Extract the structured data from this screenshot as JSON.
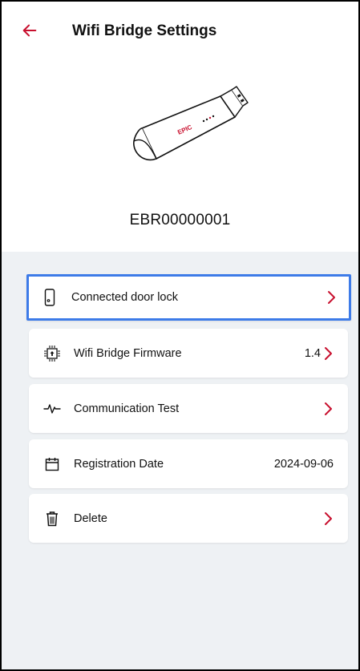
{
  "header": {
    "back_icon": "arrow-left-icon",
    "title": "Wifi Bridge Settings"
  },
  "device": {
    "brand": "EPIC",
    "serial": "EBR00000001"
  },
  "menu": [
    {
      "label": "Connected door lock",
      "value": "",
      "icon": "door-lock-icon",
      "chevron": true,
      "selected": true
    },
    {
      "label": "Wifi Bridge Firmware",
      "value": "1.4",
      "icon": "chip-icon",
      "chevron": true,
      "selected": false
    },
    {
      "label": "Communication Test",
      "value": "",
      "icon": "pulse-icon",
      "chevron": true,
      "selected": false
    },
    {
      "label": "Registration Date",
      "value": "2024-09-06",
      "icon": "calendar-icon",
      "chevron": false,
      "selected": false
    },
    {
      "label": "Delete",
      "value": "",
      "icon": "trash-icon",
      "chevron": true,
      "selected": false
    }
  ],
  "colors": {
    "accent_red": "#c8102e",
    "selection_blue": "#3d7be8",
    "list_background": "#eef1f4"
  }
}
